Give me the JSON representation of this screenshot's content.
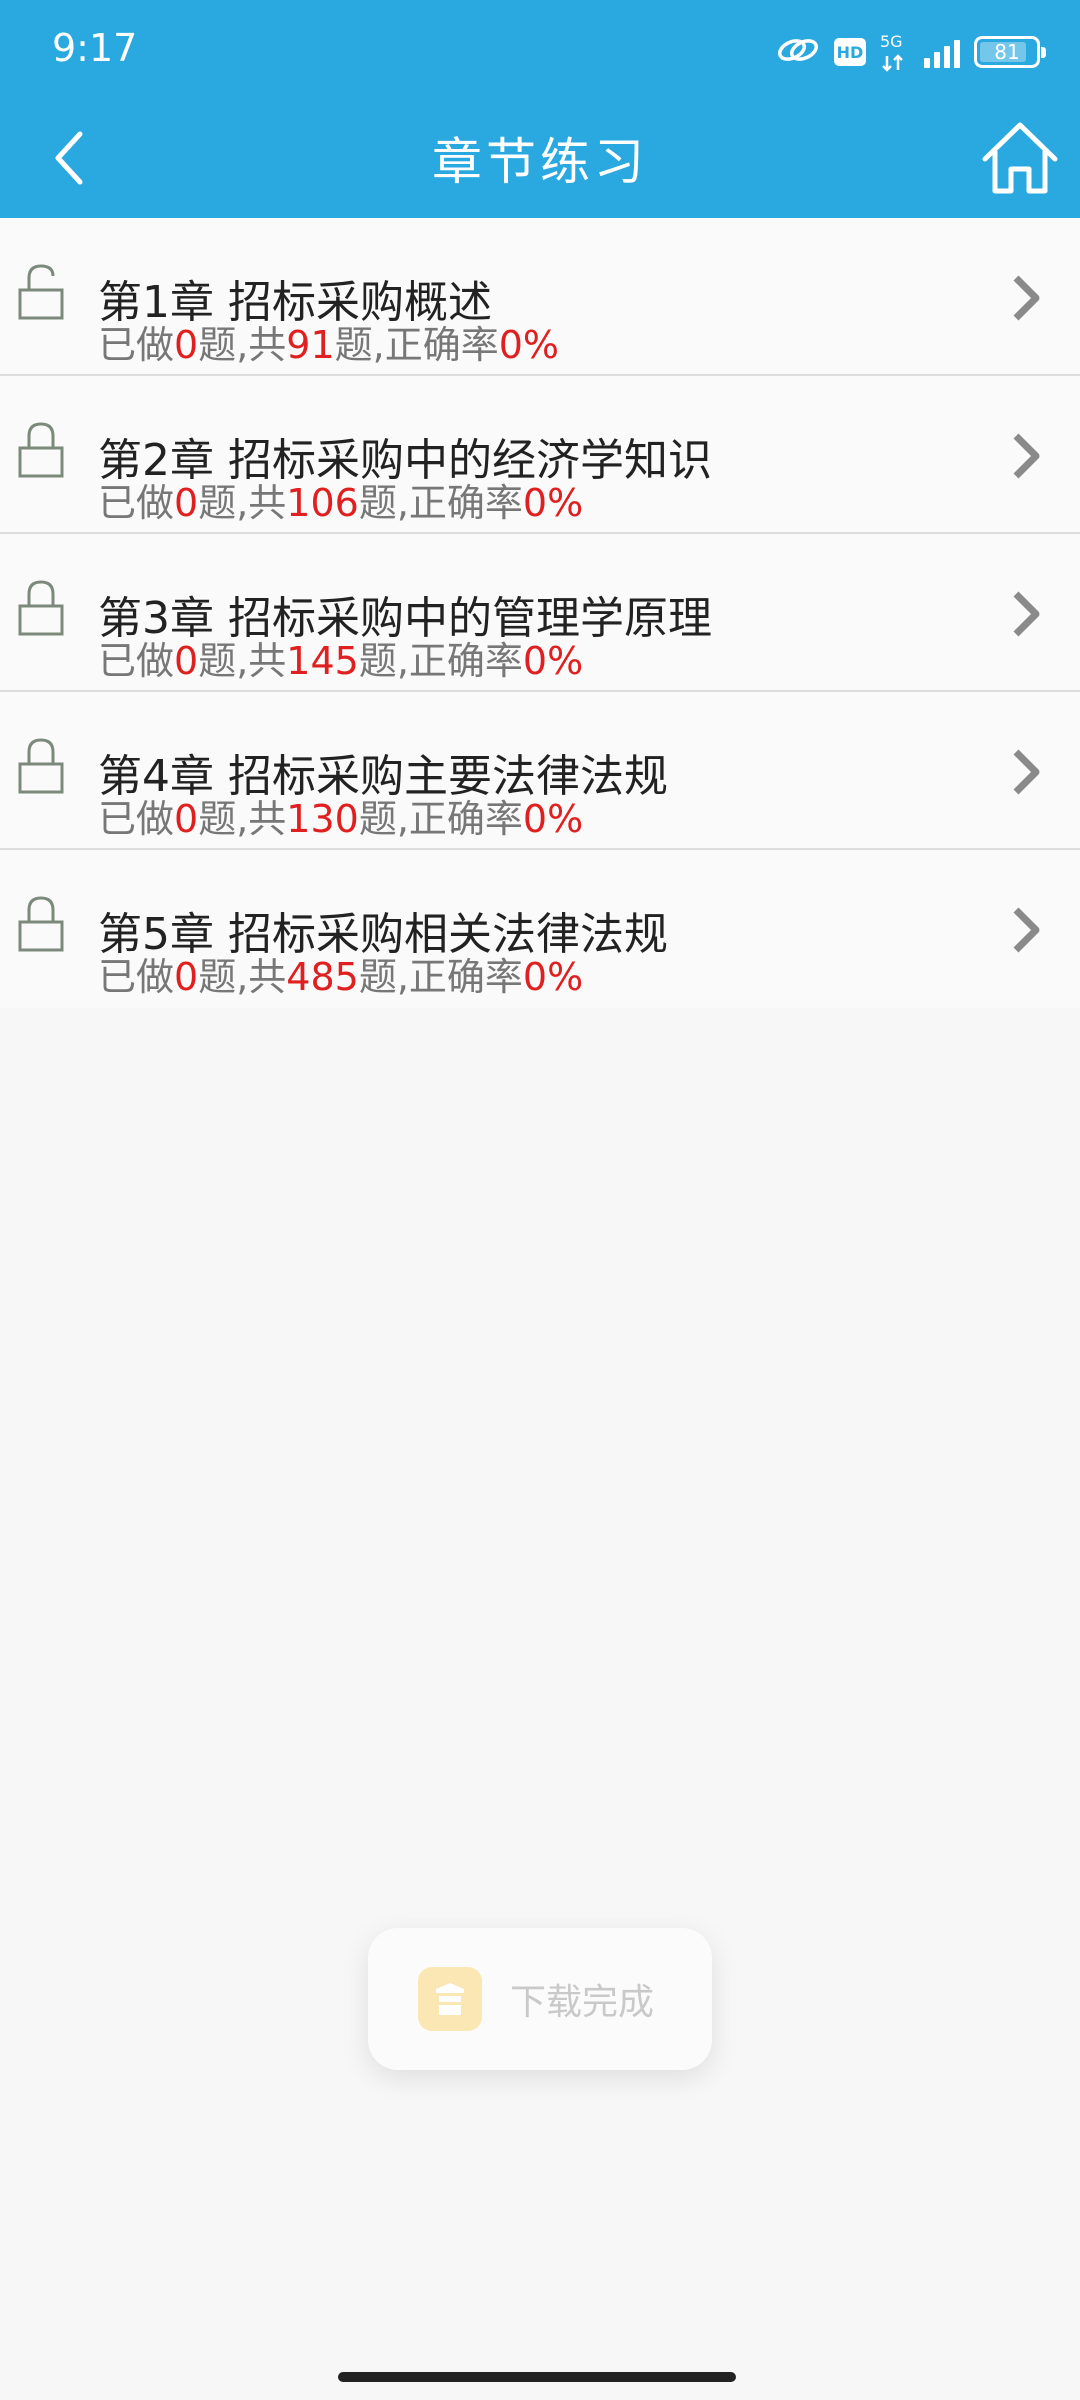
{
  "status_bar": {
    "time": "9:17",
    "hd_label": "HD",
    "network_label": "5G",
    "battery_level": "81"
  },
  "header": {
    "title": "章节练习",
    "back_icon": "chevron-left-icon",
    "home_icon": "home-icon",
    "background_color": "#2aa9e0"
  },
  "chapters": [
    {
      "title": "第1章 招标采购概述",
      "done_prefix": "已做",
      "done": "0",
      "total_prefix": "题,共",
      "total": "91",
      "rate_prefix": "题,正确率",
      "rate": "0%"
    },
    {
      "title": "第2章 招标采购中的经济学知识",
      "done_prefix": "已做",
      "done": "0",
      "total_prefix": "题,共",
      "total": "106",
      "rate_prefix": "题,正确率",
      "rate": "0%"
    },
    {
      "title": "第3章 招标采购中的管理学原理",
      "done_prefix": "已做",
      "done": "0",
      "total_prefix": "题,共",
      "total": "145",
      "rate_prefix": "题,正确率",
      "rate": "0%"
    },
    {
      "title": "第4章 招标采购主要法律法规",
      "done_prefix": "已做",
      "done": "0",
      "total_prefix": "题,共",
      "total": "130",
      "rate_prefix": "题,正确率",
      "rate": "0%"
    },
    {
      "title": "第5章 招标采购相关法律法规",
      "done_prefix": "已做",
      "done": "0",
      "total_prefix": "题,共",
      "total": "485",
      "rate_prefix": "题,正确率",
      "rate": "0%"
    }
  ],
  "toast": {
    "text": "下载完成",
    "icon": "app-icon"
  },
  "colors": {
    "accent": "#2aa9e0",
    "highlight": "#e02020"
  }
}
